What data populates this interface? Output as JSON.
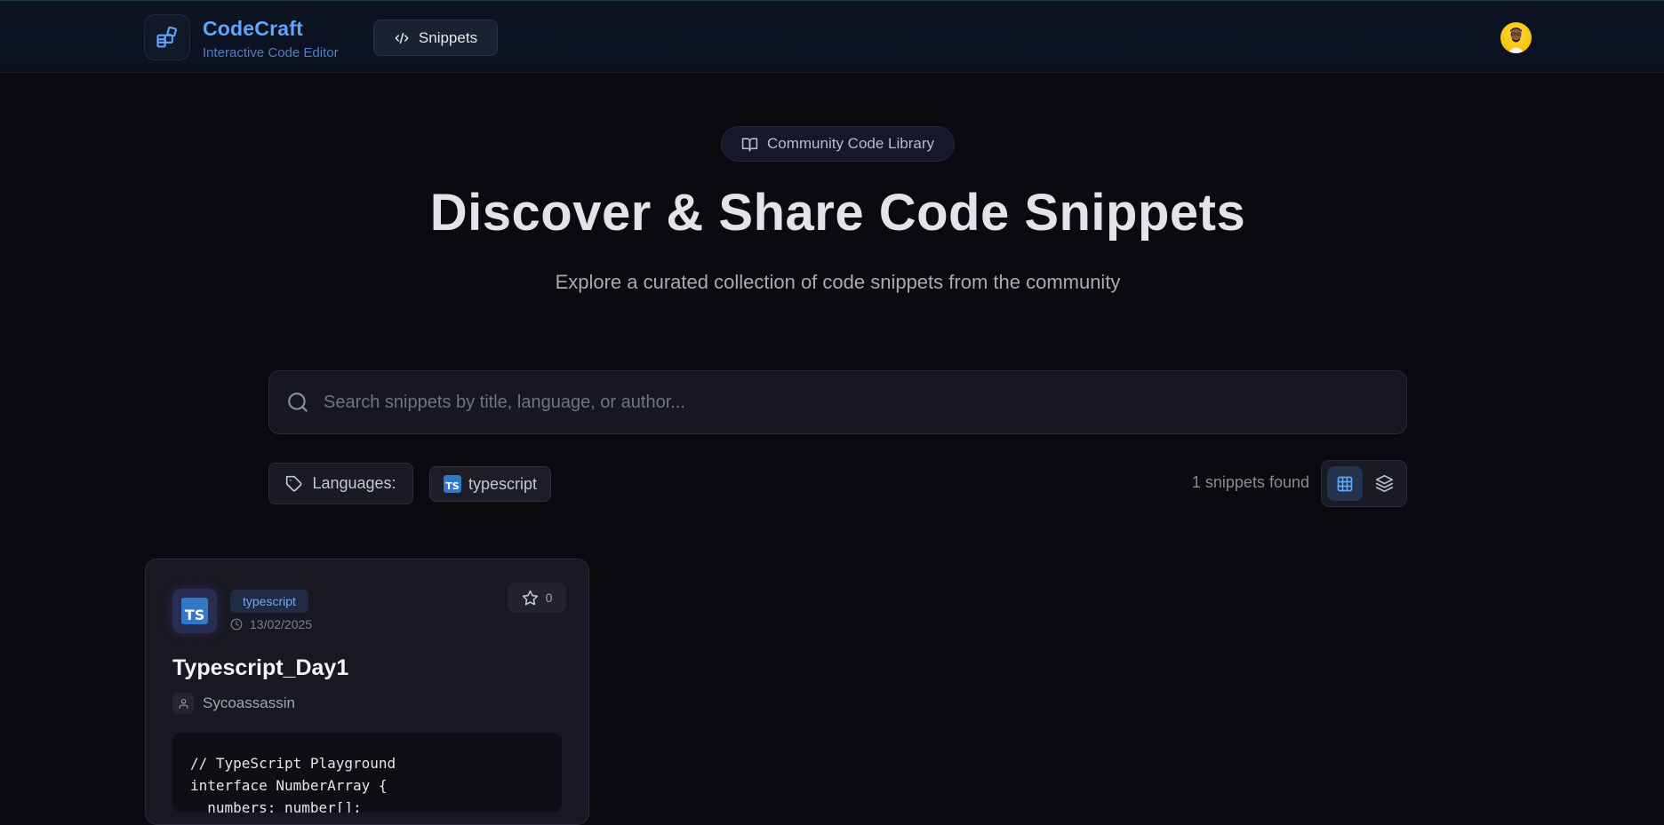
{
  "header": {
    "brand_name": "CodeCraft",
    "brand_subtitle": "Interactive Code Editor",
    "nav_snippets_label": "Snippets",
    "accent_color": "#60a5fa"
  },
  "hero": {
    "badge_label": "Community Code Library",
    "title": "Discover & Share Code Snippets",
    "subtitle": "Explore a curated collection of code snippets from the community"
  },
  "search": {
    "placeholder": "Search snippets by title, language, or author...",
    "value": ""
  },
  "filters": {
    "languages_label": "Languages:",
    "selected_language": "typescript",
    "results_count": "1 snippets found"
  },
  "icons": {
    "logo": "blocks-icon",
    "nav": "code-icon",
    "badge": "book-open-icon",
    "search": "search-icon",
    "filter": "tag-icon",
    "grid_view": "grid-icon",
    "list_view": "layers-icon",
    "star": "star-icon",
    "date": "clock-icon",
    "author": "user-icon"
  },
  "snippets": [
    {
      "language": "typescript",
      "language_logo": "TS",
      "date": "13/02/2025",
      "stars": "0",
      "title": "Typescript_Day1",
      "author": "Sycoassassin",
      "code_lines": [
        "// TypeScript Playground",
        "interface NumberArray {",
        "  numbers: number[];"
      ]
    }
  ]
}
